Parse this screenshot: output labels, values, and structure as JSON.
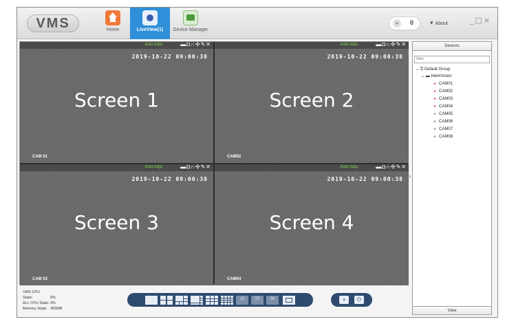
{
  "app": {
    "logo": "VMS"
  },
  "nav": {
    "home": "Home",
    "live": "LiveView(1)",
    "device": "Device Manager"
  },
  "topbar": {
    "notify_count": "0",
    "about": "About"
  },
  "screens": [
    {
      "label": "Screen 1",
      "cam": "CAM 01",
      "timestamp": "2019-10-22 09:00:38",
      "auto": "Auto Adju"
    },
    {
      "label": "Screen 2",
      "cam": "CAM02",
      "timestamp": "2019-10-22 09:00:38",
      "auto": "Auto Adju"
    },
    {
      "label": "Screen 3",
      "cam": "CAM 03",
      "timestamp": "2019-10-22 09:00:38",
      "auto": "Auto Adju"
    },
    {
      "label": "Screen 4",
      "cam": "CAM04",
      "timestamp": "2019-10-22 09:00:38",
      "auto": "Auto Adju"
    }
  ],
  "panel": {
    "title": "Devices",
    "filter_placeholder": "Filter",
    "group": "Default Group",
    "device": "HeimVision",
    "cameras": [
      "CAM01",
      "CAM02",
      "CAM03",
      "CAM04",
      "CAM05",
      "CAM06",
      "CAM07",
      "CAM08"
    ],
    "active_cameras": 4,
    "footer": "View"
  },
  "status": {
    "vms_cpu_label": "VMS CPU State:",
    "vms_cpu_value": "0%",
    "all_cpu_label": "ALL CPU State:",
    "all_cpu_value": "3%",
    "memory_label": "Memory State:",
    "memory_value": "365MB"
  },
  "layouts": {
    "extra_labels": [
      "16",
      "25",
      "36"
    ]
  }
}
